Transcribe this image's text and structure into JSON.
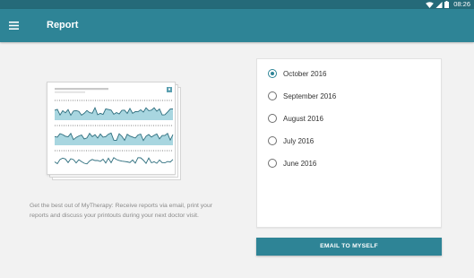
{
  "status_bar": {
    "time": "08:26",
    "icons": [
      "wifi-icon",
      "signal-icon",
      "battery-icon"
    ]
  },
  "app_bar": {
    "menu_icon": "hamburger-menu-icon",
    "title": "Report"
  },
  "preview": {
    "description": "Get the best out of MyTherapy: Receive reports via email, print your reports and discuss your printouts during your next doctor visit."
  },
  "months": {
    "selected_index": 0,
    "options": [
      {
        "label": "October 2016"
      },
      {
        "label": "September 2016"
      },
      {
        "label": "August 2016"
      },
      {
        "label": "July 2016"
      },
      {
        "label": "June 2016"
      }
    ]
  },
  "actions": {
    "email_label": "EMAIL TO MYSELF"
  },
  "colors": {
    "primary": "#2e8496",
    "status_bar": "#256a79",
    "background": "#f2f2f2",
    "chart_fill": "#a8d6e0",
    "chart_line": "#2c6d7d"
  }
}
